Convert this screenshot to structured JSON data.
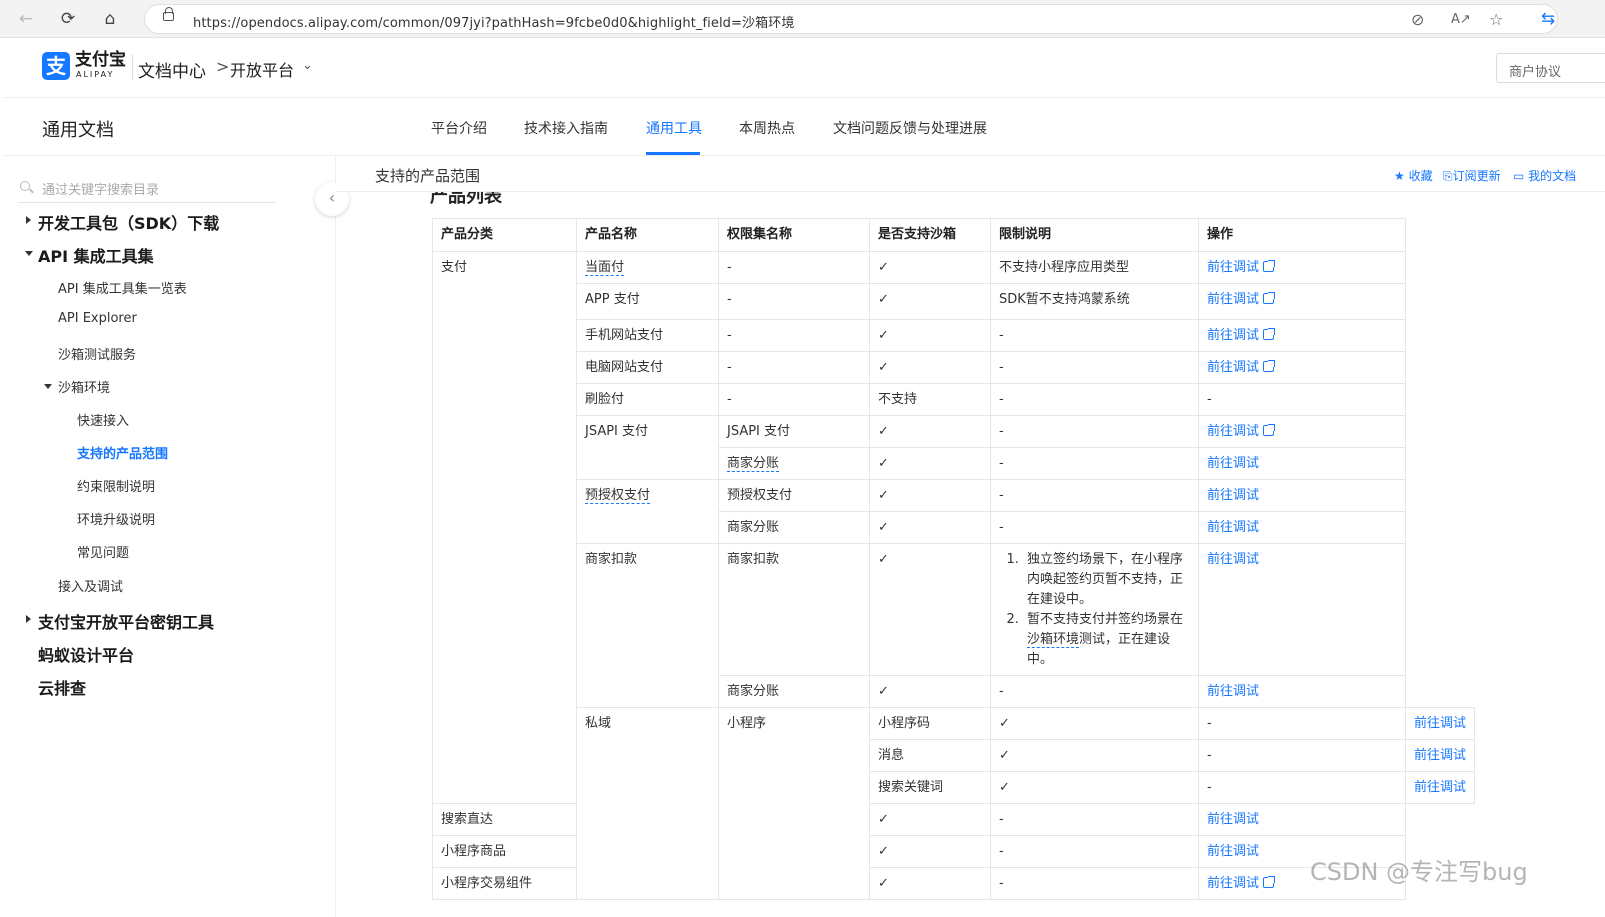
{
  "browser": {
    "url": "https://opendocs.alipay.com/common/097jyi?pathHash=9fcbe0d0&highlight_field=沙箱环境"
  },
  "header": {
    "logo_text": "支付宝",
    "logo_sub": "ALIPAY",
    "doc_center": "文档中心",
    "breadcrumb_sep": ">",
    "platform": "开放平台",
    "merchant_btn": "商户协议"
  },
  "nav": {
    "title": "通用文档",
    "tabs": [
      "平台介绍",
      "技术接入指南",
      "通用工具",
      "本周热点",
      "文档问题反馈与处理进展"
    ],
    "active_tab": "通用工具"
  },
  "sidebar": {
    "search_placeholder": "通过关键字搜索目录",
    "items": [
      {
        "label": "开发工具包（SDK）下载"
      },
      {
        "label": "API 集成工具集"
      },
      {
        "label": "API 集成工具集一览表"
      },
      {
        "label": "API Explorer"
      },
      {
        "label": "沙箱测试服务"
      },
      {
        "label": "沙箱环境"
      },
      {
        "label": "快速接入"
      },
      {
        "label": "支持的产品范围"
      },
      {
        "label": "约束限制说明"
      },
      {
        "label": "环境升级说明"
      },
      {
        "label": "常见问题"
      },
      {
        "label": "接入及调试"
      },
      {
        "label": "支付宝开放平台密钥工具"
      },
      {
        "label": "蚂蚁设计平台"
      },
      {
        "label": "云排查"
      }
    ]
  },
  "content": {
    "page_title": "支持的产品范围",
    "actions": {
      "favorite": "收藏",
      "subscribe": "订阅更新",
      "my_docs": "我的文档"
    },
    "partial_heading": "产品列表"
  },
  "table": {
    "headers": [
      "产品分类",
      "产品名称",
      "权限集名称",
      "是否支持沙箱",
      "限制说明",
      "操作"
    ],
    "category_pay": "支付",
    "category_private": "私域",
    "products": {
      "dmf": "当面付",
      "app": "APP 支付",
      "wap": "手机网站支付",
      "page": "电脑网站支付",
      "face": "刷脸付",
      "jsapi": "JSAPI 支付",
      "preauth": "预授权支付",
      "deduct": "商家扣款",
      "miniapp": "小程序"
    },
    "perms": {
      "dash": "-",
      "jsapi": "JSAPI 支付",
      "split": "商家分账",
      "preauth": "预授权支付",
      "deduct": "商家扣款",
      "qrcode": "小程序码",
      "message": "消息",
      "keyword": "搜索关键词",
      "direct": "搜索直达",
      "goods": "小程序商品",
      "trade": "小程序交易组件"
    },
    "support": {
      "yes": "✓",
      "no": "不支持"
    },
    "limits": {
      "no_miniapp": "不支持小程序应用类型",
      "no_harmony": "SDK暂不支持鸿蒙系统",
      "dash": "-",
      "deduct_1": "独立签约场景下，在小程序内唤起签约页暂不支持，正在建设中。",
      "deduct_2a": "暂不支持支付并签约场景在",
      "deduct_2b": "沙箱环境",
      "deduct_2c": "测试，正在建设中。"
    },
    "action_label": "前往调试",
    "action_none": "-"
  },
  "watermark": "CSDN @专注写bug"
}
